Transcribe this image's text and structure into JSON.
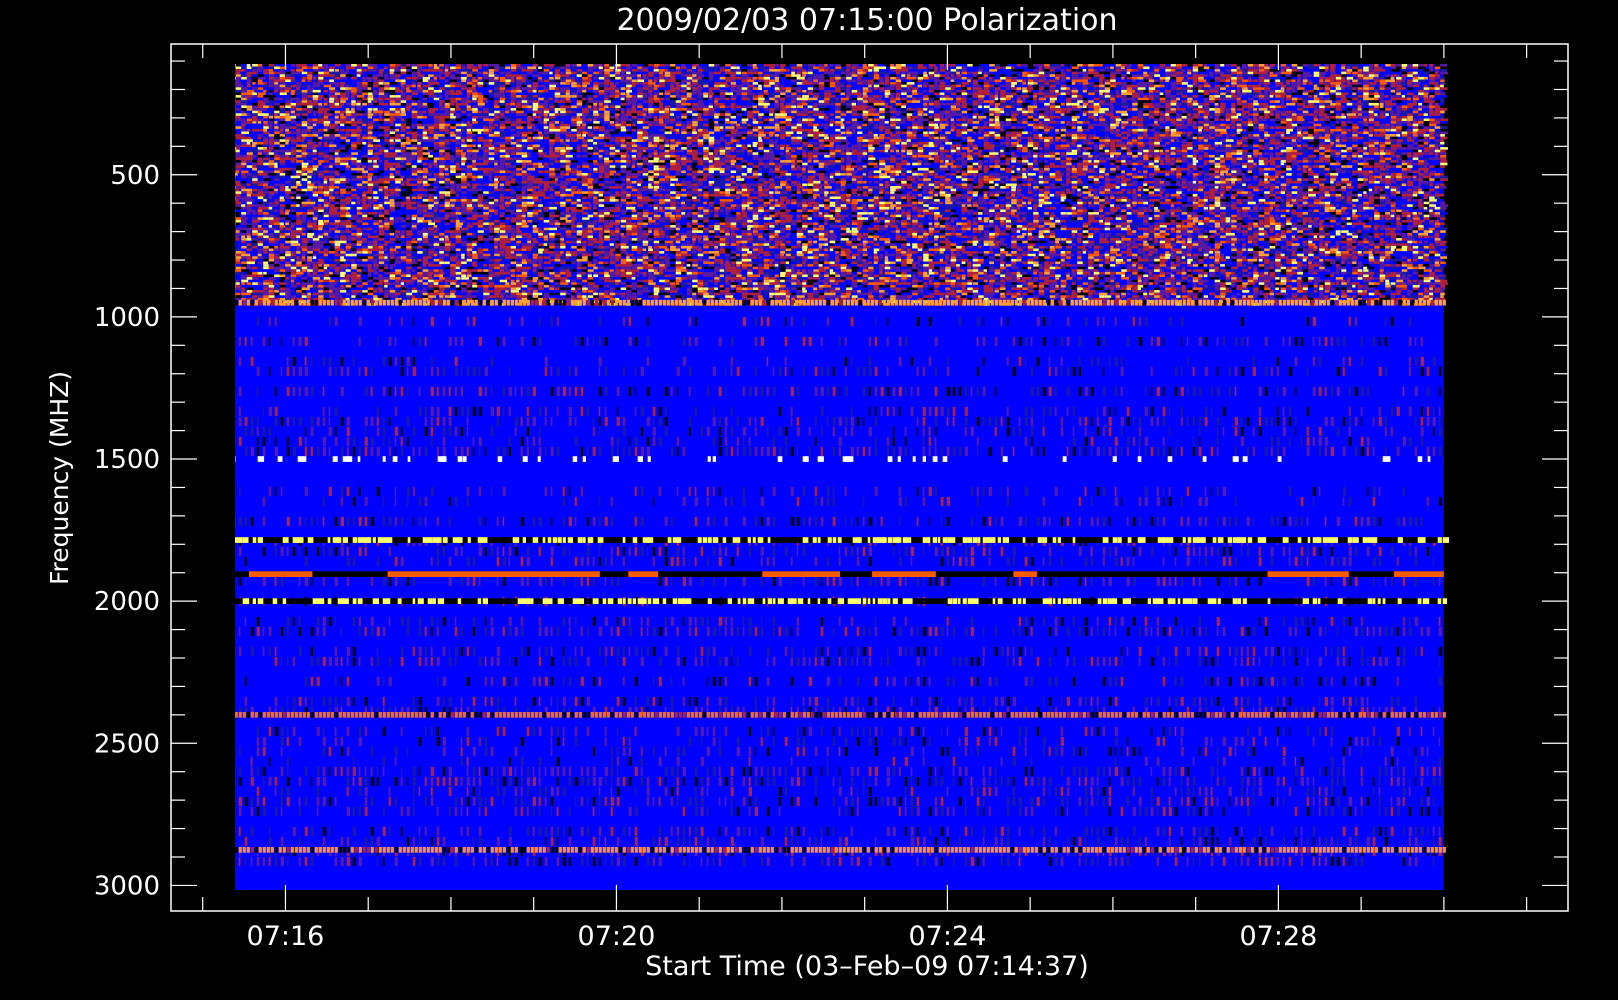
{
  "chart_data": {
    "type": "heatmap",
    "title": "2009/02/03 07:15:00 Polarization",
    "xlabel": "Start Time (03–Feb–09 07:14:37)",
    "ylabel": "Frequency (MHZ)",
    "x_range": [
      "07:14:37",
      "07:31:30"
    ],
    "x_data_range": [
      "07:15:00",
      "07:30:00"
    ],
    "x_ticks": [
      {
        "value": "07:16",
        "label": "07:16"
      },
      {
        "value": "07:20",
        "label": "07:20"
      },
      {
        "value": "07:24",
        "label": "07:24"
      },
      {
        "value": "07:28",
        "label": "07:28"
      }
    ],
    "ylim": [
      3090,
      40
    ],
    "y_data_range": [
      110,
      3020
    ],
    "y_ticks": [
      {
        "value": 500,
        "label": "500"
      },
      {
        "value": 1000,
        "label": "1000"
      },
      {
        "value": 1500,
        "label": "1500"
      },
      {
        "value": 2000,
        "label": "2000"
      },
      {
        "value": 2500,
        "label": "2500"
      },
      {
        "value": 3000,
        "label": "3000"
      }
    ],
    "colormap": [
      "#000000",
      "#1a1aa0",
      "#0000ff",
      "#5a1aa0",
      "#b0203a",
      "#ff5a00",
      "#ffa030",
      "#ffff70",
      "#ffffff"
    ],
    "background_color": "#0000ff",
    "bands": [
      {
        "freq": [
          110,
          960
        ],
        "kind": "noise_hot"
      },
      {
        "freq": [
          940,
          960
        ],
        "kind": "line",
        "color": "#ffa030"
      },
      {
        "freq": [
          1490,
          1510
        ],
        "kind": "bright",
        "color": "#ffffff"
      },
      {
        "freq": [
          1775,
          1795
        ],
        "kind": "bright",
        "color": "#ffff70"
      },
      {
        "freq": [
          1895,
          1915
        ],
        "kind": "blocks",
        "color": "#ff5a00"
      },
      {
        "freq": [
          1990,
          2010
        ],
        "kind": "bright",
        "color": "#ffff70"
      },
      {
        "freq": [
          2390,
          2410
        ],
        "kind": "line",
        "color": "#ff6a10"
      },
      {
        "freq": [
          2865,
          2885
        ],
        "kind": "line",
        "color": "#ff8c30"
      }
    ]
  }
}
